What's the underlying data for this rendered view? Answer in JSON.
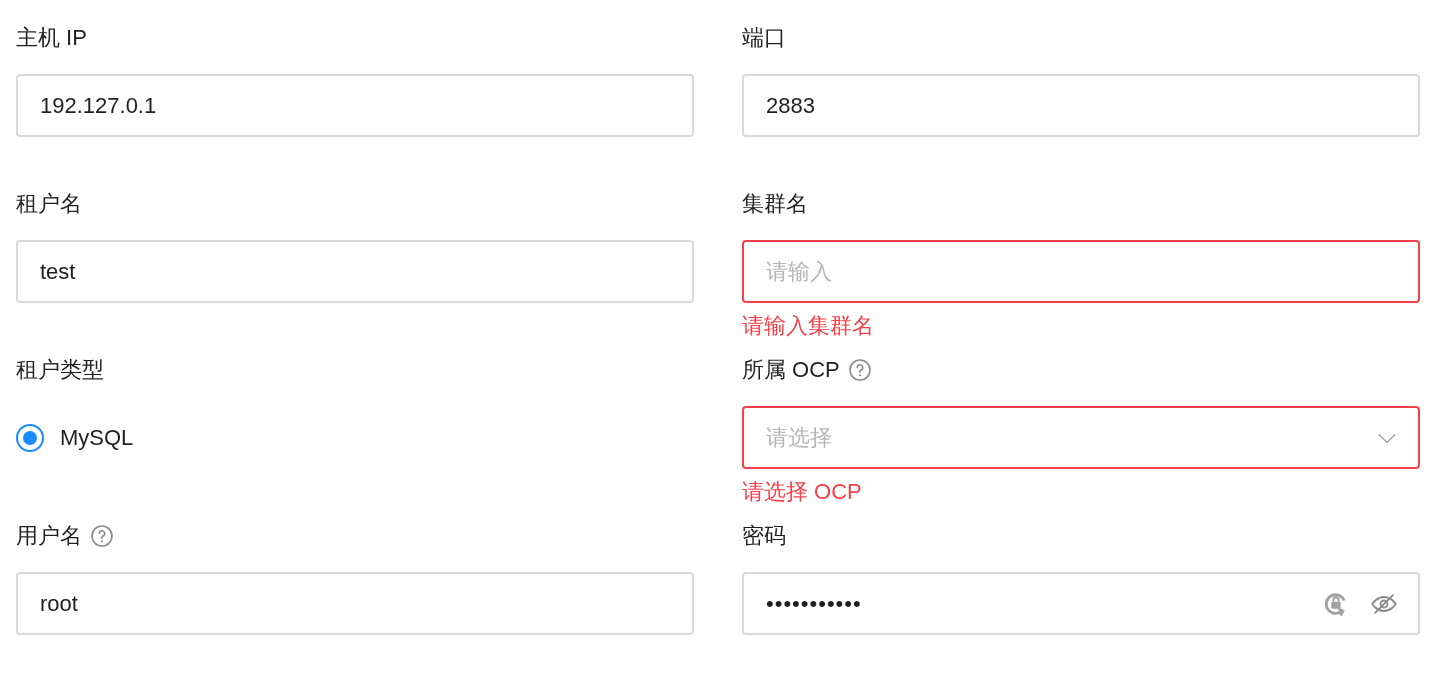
{
  "fields": [
    {
      "kind": "input",
      "label": "主机 IP",
      "help": false,
      "value": "192.127.0.1",
      "invalid": false
    },
    {
      "kind": "input",
      "label": "端口",
      "help": false,
      "value": "2883",
      "invalid": false
    },
    {
      "kind": "input",
      "label": "租户名",
      "help": false,
      "value": "test",
      "invalid": false
    },
    {
      "kind": "input",
      "label": "集群名",
      "help": false,
      "placeholder": "请输入",
      "invalid": true,
      "error": "请输入集群名"
    },
    {
      "kind": "radio",
      "label": "租户类型",
      "help": false,
      "options": [
        {
          "label": "MySQL",
          "selected": true
        }
      ]
    },
    {
      "kind": "select",
      "label": "所属 OCP",
      "help": true,
      "placeholder": "请选择",
      "invalid": true,
      "error": "请选择 OCP"
    },
    {
      "kind": "input",
      "label": "用户名",
      "help": true,
      "value": "root",
      "invalid": false
    },
    {
      "kind": "password",
      "label": "密码",
      "help": false,
      "value": "•••••••••••",
      "invalid": false
    }
  ]
}
